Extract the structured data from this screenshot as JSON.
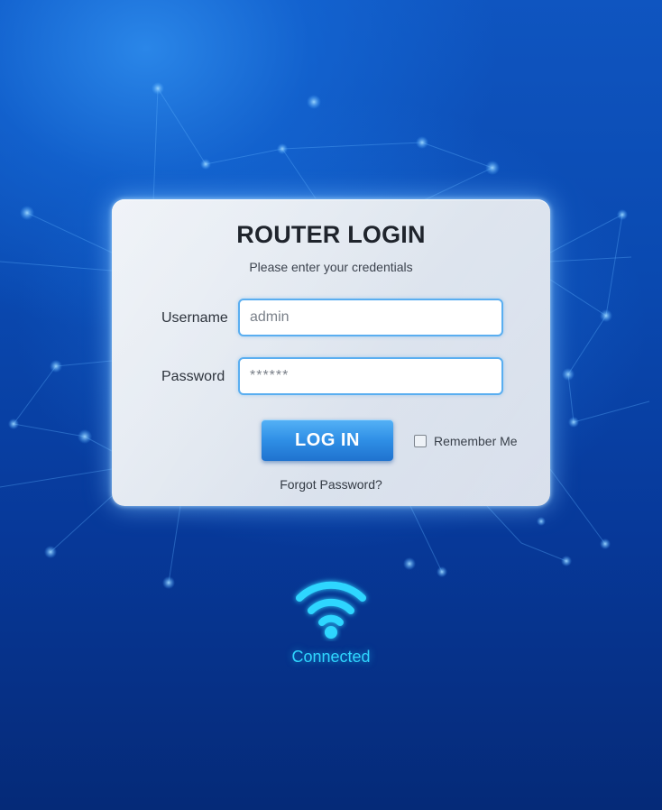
{
  "login_card": {
    "title": "ROUTER LOGIN",
    "subtitle": "Please enter your credentials",
    "username_label": "Username",
    "username_value": "admin",
    "password_label": "Password",
    "password_value": "******",
    "login_button_label": "LOG IN",
    "remember_me_label": "Remember Me",
    "remember_me_checked": false,
    "forgot_password_label": "Forgot Password?"
  },
  "status": {
    "icon": "wifi-icon",
    "label": "Connected",
    "color": "#2fd6ff"
  },
  "colors": {
    "background": "#0a49b0",
    "accent": "#2f8fe6",
    "input_border": "#5aaef0"
  }
}
